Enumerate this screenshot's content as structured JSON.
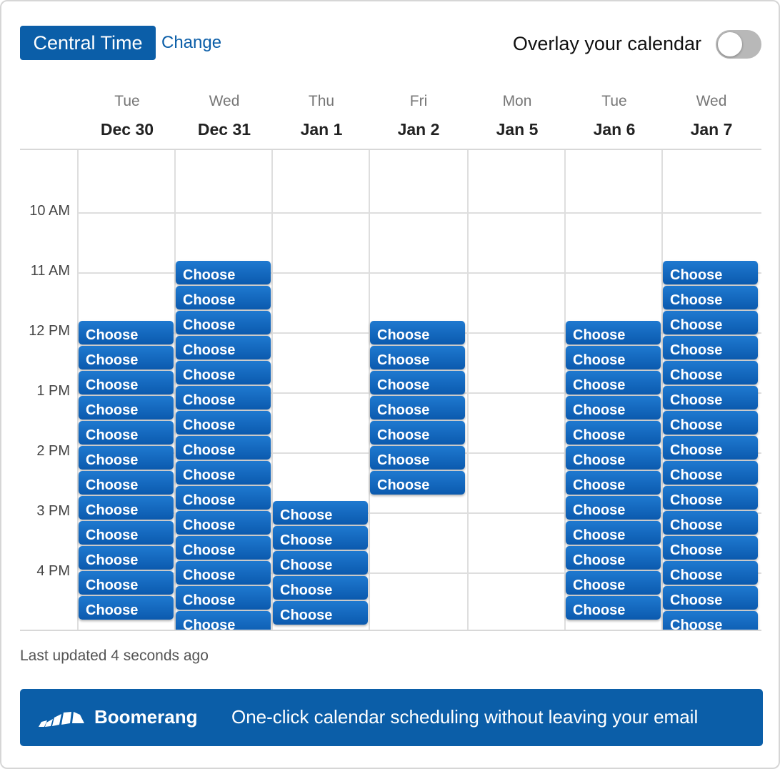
{
  "header": {
    "timezone_label": "Central Time",
    "change_label": "Change",
    "overlay_label": "Overlay your calendar",
    "overlay_enabled": false
  },
  "days": [
    {
      "dow": "Tue",
      "date": "Dec 30"
    },
    {
      "dow": "Wed",
      "date": "Dec 31"
    },
    {
      "dow": "Thu",
      "date": "Jan 1"
    },
    {
      "dow": "Fri",
      "date": "Jan 2"
    },
    {
      "dow": "Mon",
      "date": "Jan 5"
    },
    {
      "dow": "Tue",
      "date": "Jan 6"
    },
    {
      "dow": "Wed",
      "date": "Jan 7"
    }
  ],
  "hours": [
    "10 AM",
    "11 AM",
    "12 PM",
    "1 PM",
    "2 PM",
    "3 PM",
    "4 PM"
  ],
  "slot_label": "Choose",
  "slot_counts": [
    12,
    15,
    5,
    7,
    0,
    12,
    15
  ],
  "slot_start_hours": [
    12,
    11,
    15,
    12,
    null,
    12,
    11
  ],
  "footer": {
    "last_updated": "Last updated 4 seconds ago"
  },
  "banner": {
    "brand": "Boomerang",
    "tagline": "One-click calendar scheduling without leaving your email"
  },
  "colors": {
    "primary": "#0b5ea8",
    "toggle_off": "#b8b8b8"
  },
  "icons": {
    "brand_logo": "boomerang-logo-icon"
  }
}
